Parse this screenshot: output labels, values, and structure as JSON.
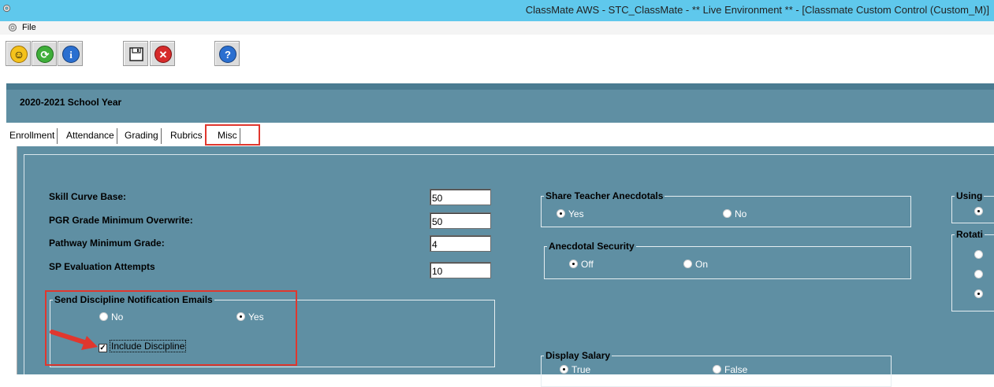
{
  "window": {
    "title": "ClassMate AWS - STC_ClassMate - ** Live Environment ** - [Classmate Custom Control (Custom_M)]"
  },
  "menu": {
    "file_label": "File"
  },
  "toolbar": {
    "buttons": [
      {
        "icon": "smiley-icon"
      },
      {
        "icon": "refresh-icon"
      },
      {
        "icon": "info-icon"
      },
      {
        "icon": "save-icon"
      },
      {
        "icon": "cancel-icon"
      },
      {
        "icon": "help-icon"
      }
    ]
  },
  "header": {
    "school_year": "2020-2021 School Year"
  },
  "tabs": [
    {
      "label": "Enrollment"
    },
    {
      "label": "Attendance"
    },
    {
      "label": "Grading"
    },
    {
      "label": "Rubrics"
    },
    {
      "label": "Misc",
      "active": true
    }
  ],
  "misc": {
    "skill_curve_base": {
      "label": "Skill Curve Base:",
      "value": "50"
    },
    "pgr_grade_min": {
      "label": "PGR Grade Minimum Overwrite:",
      "value": "50"
    },
    "pathway_min_grade": {
      "label": "Pathway Minimum Grade:",
      "value": "4"
    },
    "sp_eval_attempts": {
      "label": "SP Evaluation Attempts",
      "value": "10"
    },
    "send_discipline": {
      "title": "Send Discipline Notification Emails",
      "options": [
        {
          "label": "No",
          "selected": false
        },
        {
          "label": "Yes",
          "selected": true
        }
      ],
      "include_discipline": {
        "label": "Include Discipline",
        "checked": true
      }
    },
    "share_teacher_anecdotals": {
      "title": "Share Teacher Anecdotals",
      "options": [
        {
          "label": "Yes",
          "selected": true
        },
        {
          "label": "No",
          "selected": false
        }
      ]
    },
    "anecdotal_security": {
      "title": "Anecdotal Security",
      "options": [
        {
          "label": "Off",
          "selected": true
        },
        {
          "label": "On",
          "selected": false
        }
      ]
    },
    "display_salary": {
      "title": "Display Salary",
      "options": [
        {
          "label": "True",
          "selected": true
        },
        {
          "label": "False",
          "selected": false
        }
      ]
    },
    "using_group": {
      "title": "Using"
    },
    "rotation_group": {
      "title": "Rotati"
    }
  },
  "colors": {
    "titlebar": "#5fc8ec",
    "panel": "#5f8fa3",
    "highlight": "#e0372e"
  }
}
